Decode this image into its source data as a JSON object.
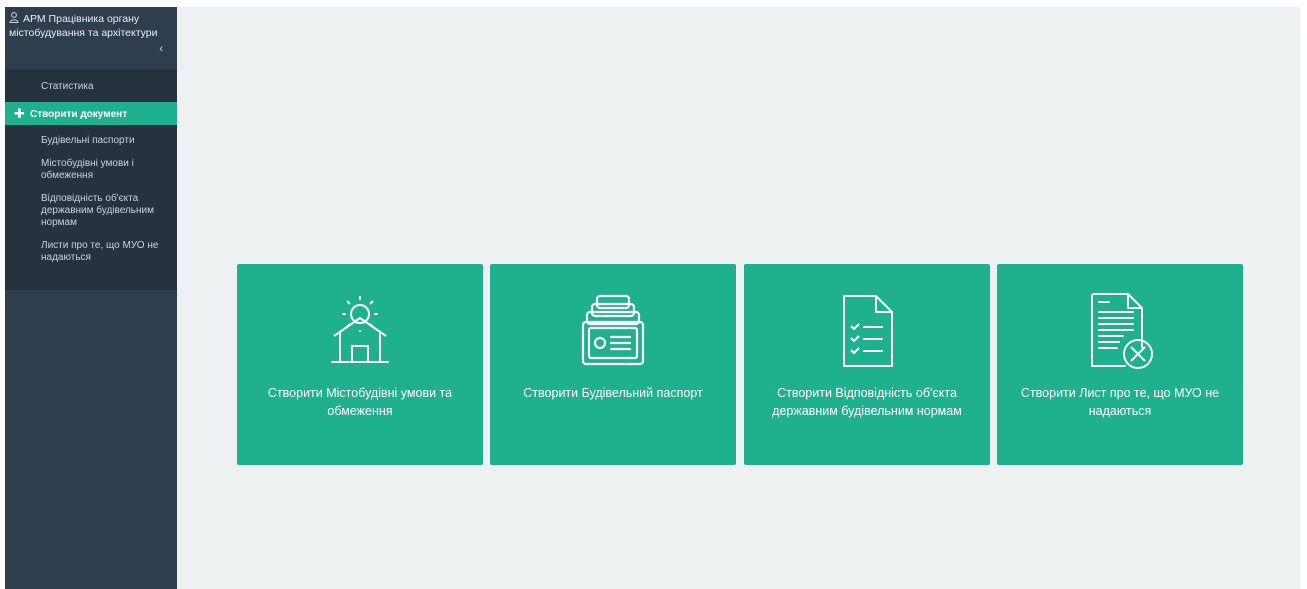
{
  "sidebar": {
    "header": {
      "title": "АРМ Працівника органу містобудування та архітектури",
      "user_icon": "user-icon",
      "collapse_icon": "chevron-left-icon"
    },
    "items": [
      {
        "label": "Статистика"
      },
      {
        "label": "Створити документ",
        "active": true,
        "icon": "plus-icon"
      },
      {
        "label": "Будівельні паспорти"
      },
      {
        "label": "Містобудівні умови і обмеження"
      },
      {
        "label": "Відповідність об'єкта державним будівельним нормам"
      },
      {
        "label": "Листи про те, що МУО не надаються"
      }
    ]
  },
  "cards": [
    {
      "label": "Створити Містобудівні умови та обмеження",
      "icon": "building-gear-icon"
    },
    {
      "label": "Створити Будівельний паспорт",
      "icon": "card-file-icon"
    },
    {
      "label": "Створити Відповідність об'єкта державним будівельним нормам",
      "icon": "checklist-document-icon"
    },
    {
      "label": "Створити Лист про те, що МУО не надаються",
      "icon": "document-cancel-icon"
    }
  ],
  "colors": {
    "accent": "#1fb18e",
    "sidebar_bg": "#2f3e4e",
    "sidebar_menu_bg": "#26333f",
    "main_bg": "#eef1f2"
  }
}
